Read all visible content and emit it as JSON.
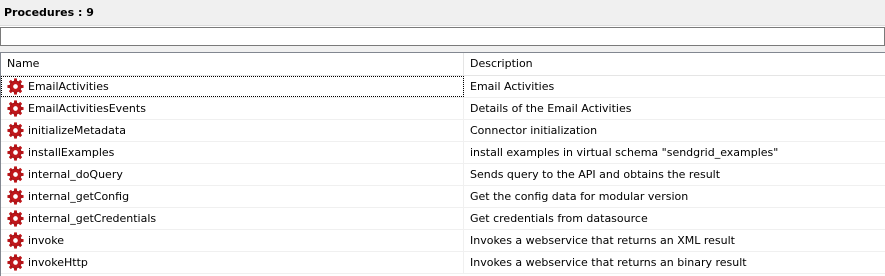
{
  "panel": {
    "title": "Procedures : 9"
  },
  "filter": {
    "value": "",
    "placeholder": ""
  },
  "table": {
    "columns": [
      "Name",
      "Description"
    ],
    "rows": [
      {
        "name": "EmailActivities",
        "description": "Email Activities",
        "icon": "gear-icon"
      },
      {
        "name": "EmailActivitiesEvents",
        "description": "Details of the Email Activities",
        "icon": "gear-icon"
      },
      {
        "name": "initializeMetadata",
        "description": "Connector initialization",
        "icon": "gear-icon"
      },
      {
        "name": "installExamples",
        "description": "install examples in virtual schema \"sendgrid_examples\"",
        "icon": "gear-icon"
      },
      {
        "name": "internal_doQuery",
        "description": "Sends query to the API and obtains the result",
        "icon": "gear-icon"
      },
      {
        "name": "internal_getConfig",
        "description": "Get the config data for modular version",
        "icon": "gear-icon"
      },
      {
        "name": "internal_getCredentials",
        "description": "Get credentials from datasource",
        "icon": "gear-icon"
      },
      {
        "name": "invoke",
        "description": "Invokes a webservice that returns an XML result",
        "icon": "gear-icon"
      },
      {
        "name": "invokeHttp",
        "description": "Invokes a webservice that returns an binary result",
        "icon": "gear-icon"
      }
    ]
  },
  "colors": {
    "gear": "#c0171b",
    "header_bg": "#f0f0f0"
  }
}
